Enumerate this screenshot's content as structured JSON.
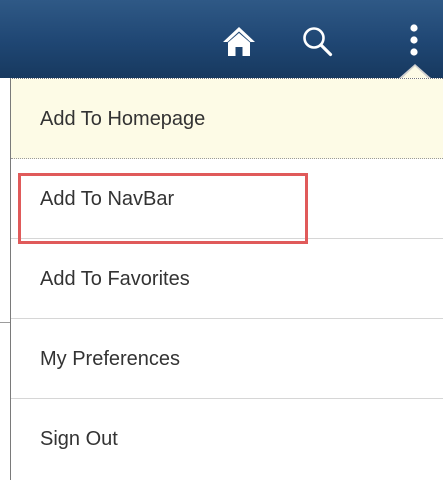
{
  "header": {
    "icons": [
      "home-icon",
      "search-icon",
      "more-vertical-icon"
    ],
    "colors": {
      "bar": "#1f4673",
      "icon": "#ffffff"
    }
  },
  "menu": {
    "items": [
      {
        "label": "Add To Homepage",
        "state": "hovered"
      },
      {
        "label": "Add To NavBar"
      },
      {
        "label": "Add To Favorites",
        "annotated": true
      },
      {
        "label": "My Preferences"
      },
      {
        "label": "Sign Out"
      }
    ],
    "colors": {
      "hover_bg": "#fdfbe6",
      "annotation_border": "#e05a5a",
      "text": "#333333"
    }
  }
}
